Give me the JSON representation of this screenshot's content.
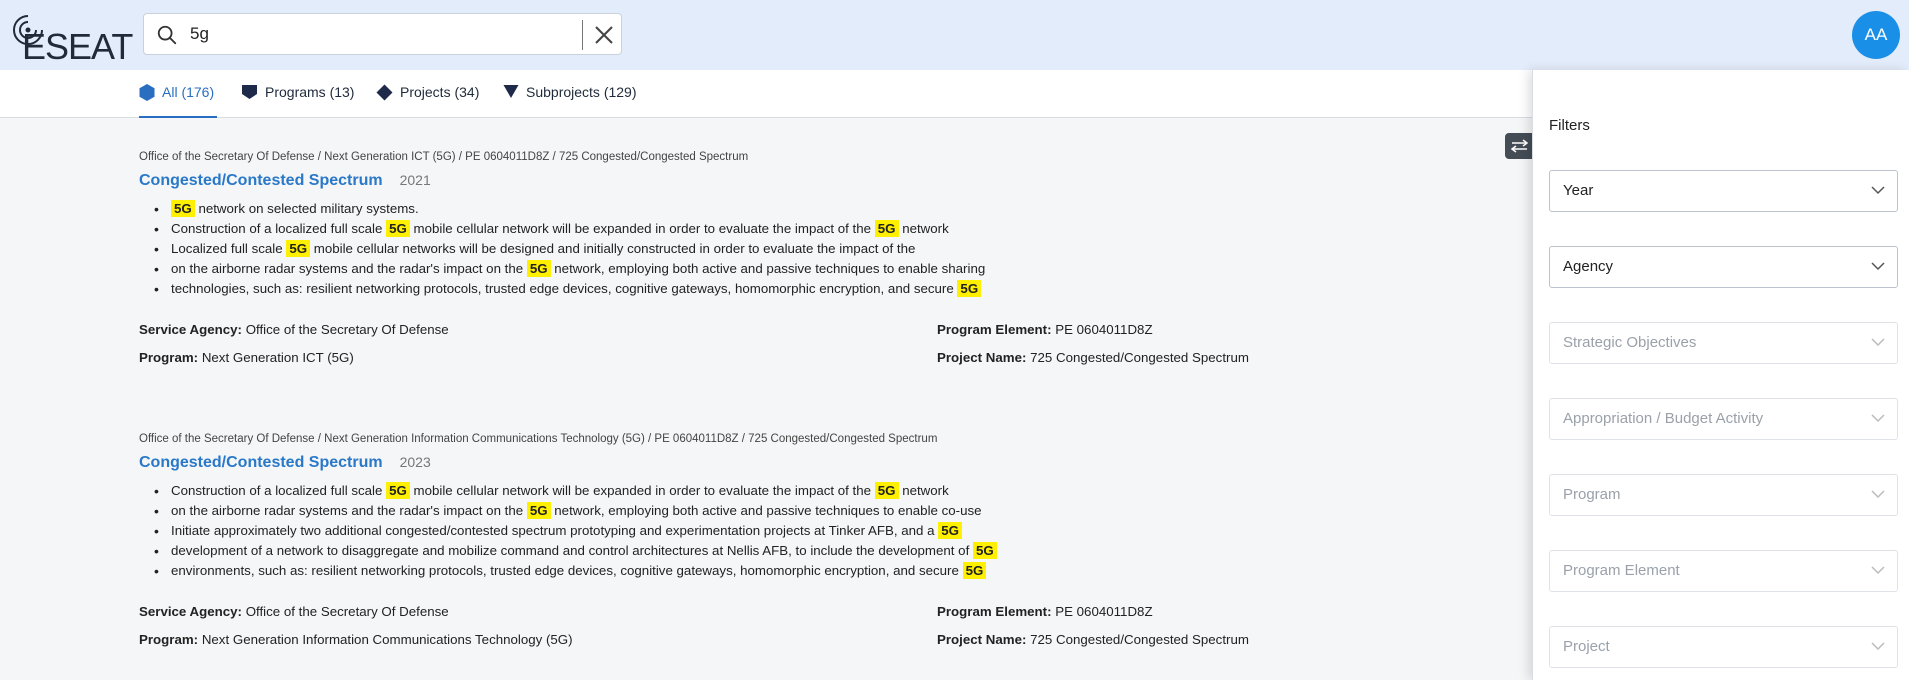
{
  "app": {
    "logo_text": "ESEAT"
  },
  "search": {
    "value": "5g",
    "placeholder": ""
  },
  "user": {
    "initials": "AA"
  },
  "tabs": [
    {
      "label": "All (176)",
      "icon": "hexagon-icon",
      "active": true
    },
    {
      "label": "Programs (13)",
      "icon": "pentagon-icon",
      "active": false
    },
    {
      "label": "Projects (34)",
      "icon": "diamond-icon",
      "active": false
    },
    {
      "label": "Subprojects (129)",
      "icon": "triangle-down-icon",
      "active": false
    }
  ],
  "results": [
    {
      "breadcrumb": "Office of the Secretary Of Defense / Next Generation ICT (5G) / PE 0604011D8Z / 725 Congested/Congested Spectrum",
      "title": "Congested/Contested Spectrum",
      "year": "2021",
      "bullets": [
        [
          {
            "h": "5G"
          },
          {
            "t": " network on selected military systems."
          }
        ],
        [
          {
            "t": "Construction of a localized full scale "
          },
          {
            "h": "5G"
          },
          {
            "t": " mobile cellular network will be expanded in order to evaluate the impact of the "
          },
          {
            "h": "5G"
          },
          {
            "t": " network"
          }
        ],
        [
          {
            "t": "Localized full scale "
          },
          {
            "h": "5G"
          },
          {
            "t": " mobile cellular networks will be designed and initially constructed in order to evaluate the impact of the"
          }
        ],
        [
          {
            "t": "on the airborne radar systems and the radar's impact on the "
          },
          {
            "h": "5G"
          },
          {
            "t": " network, employing both active and passive techniques to enable sharing"
          }
        ],
        [
          {
            "t": "technologies, such as: resilient networking protocols, trusted edge devices, cognitive gateways, homomorphic encryption, and secure "
          },
          {
            "h": "5G"
          }
        ]
      ],
      "service_agency_label": "Service Agency:",
      "service_agency": "Office of the Secretary Of Defense",
      "program_label": "Program:",
      "program": "Next Generation ICT (5G)",
      "program_element_label": "Program Element:",
      "program_element": "PE 0604011D8Z",
      "project_name_label": "Project Name:",
      "project_name": "725 Congested/Congested Spectrum"
    },
    {
      "breadcrumb": "Office of the Secretary Of Defense / Next Generation Information Communications Technology (5G) / PE 0604011D8Z / 725 Congested/Congested Spectrum",
      "title": "Congested/Contested Spectrum",
      "year": "2023",
      "bullets": [
        [
          {
            "t": "Construction of a localized full scale "
          },
          {
            "h": "5G"
          },
          {
            "t": " mobile cellular network will be expanded in order to evaluate the impact of the "
          },
          {
            "h": "5G"
          },
          {
            "t": " network"
          }
        ],
        [
          {
            "t": "on the airborne radar systems and the radar's impact on the "
          },
          {
            "h": "5G"
          },
          {
            "t": " network, employing both active and passive techniques to enable co-use"
          }
        ],
        [
          {
            "t": "Initiate approximately two additional congested/contested spectrum prototyping and experimentation projects at Tinker AFB, and a "
          },
          {
            "h": "5G"
          }
        ],
        [
          {
            "t": "development of a network to disaggregate and mobilize command and control architectures at Nellis AFB, to include the development of "
          },
          {
            "h": "5G"
          }
        ],
        [
          {
            "t": "environments, such as: resilient networking protocols, trusted edge devices, cognitive gateways, homomorphic encryption, and secure "
          },
          {
            "h": "5G"
          }
        ]
      ],
      "service_agency_label": "Service Agency:",
      "service_agency": "Office of the Secretary Of Defense",
      "program_label": "Program:",
      "program": "Next Generation Information Communications Technology (5G)",
      "program_element_label": "Program Element:",
      "program_element": "PE 0604011D8Z",
      "project_name_label": "Project Name:",
      "project_name": "725 Congested/Congested Spectrum"
    }
  ],
  "filters": {
    "title": "Filters",
    "items": [
      {
        "label": "Year",
        "enabled": true
      },
      {
        "label": "Agency",
        "enabled": true
      },
      {
        "label": "Strategic Objectives",
        "enabled": false
      },
      {
        "label": "Appropriation / Budget Activity",
        "enabled": false
      },
      {
        "label": "Program",
        "enabled": false
      },
      {
        "label": "Program Element",
        "enabled": false
      },
      {
        "label": "Project",
        "enabled": false
      }
    ]
  },
  "colors": {
    "accent": "#2a78c8",
    "highlight": "#ffef00",
    "avatar": "#1a8fe8",
    "header_bg": "#e3ecfa"
  }
}
